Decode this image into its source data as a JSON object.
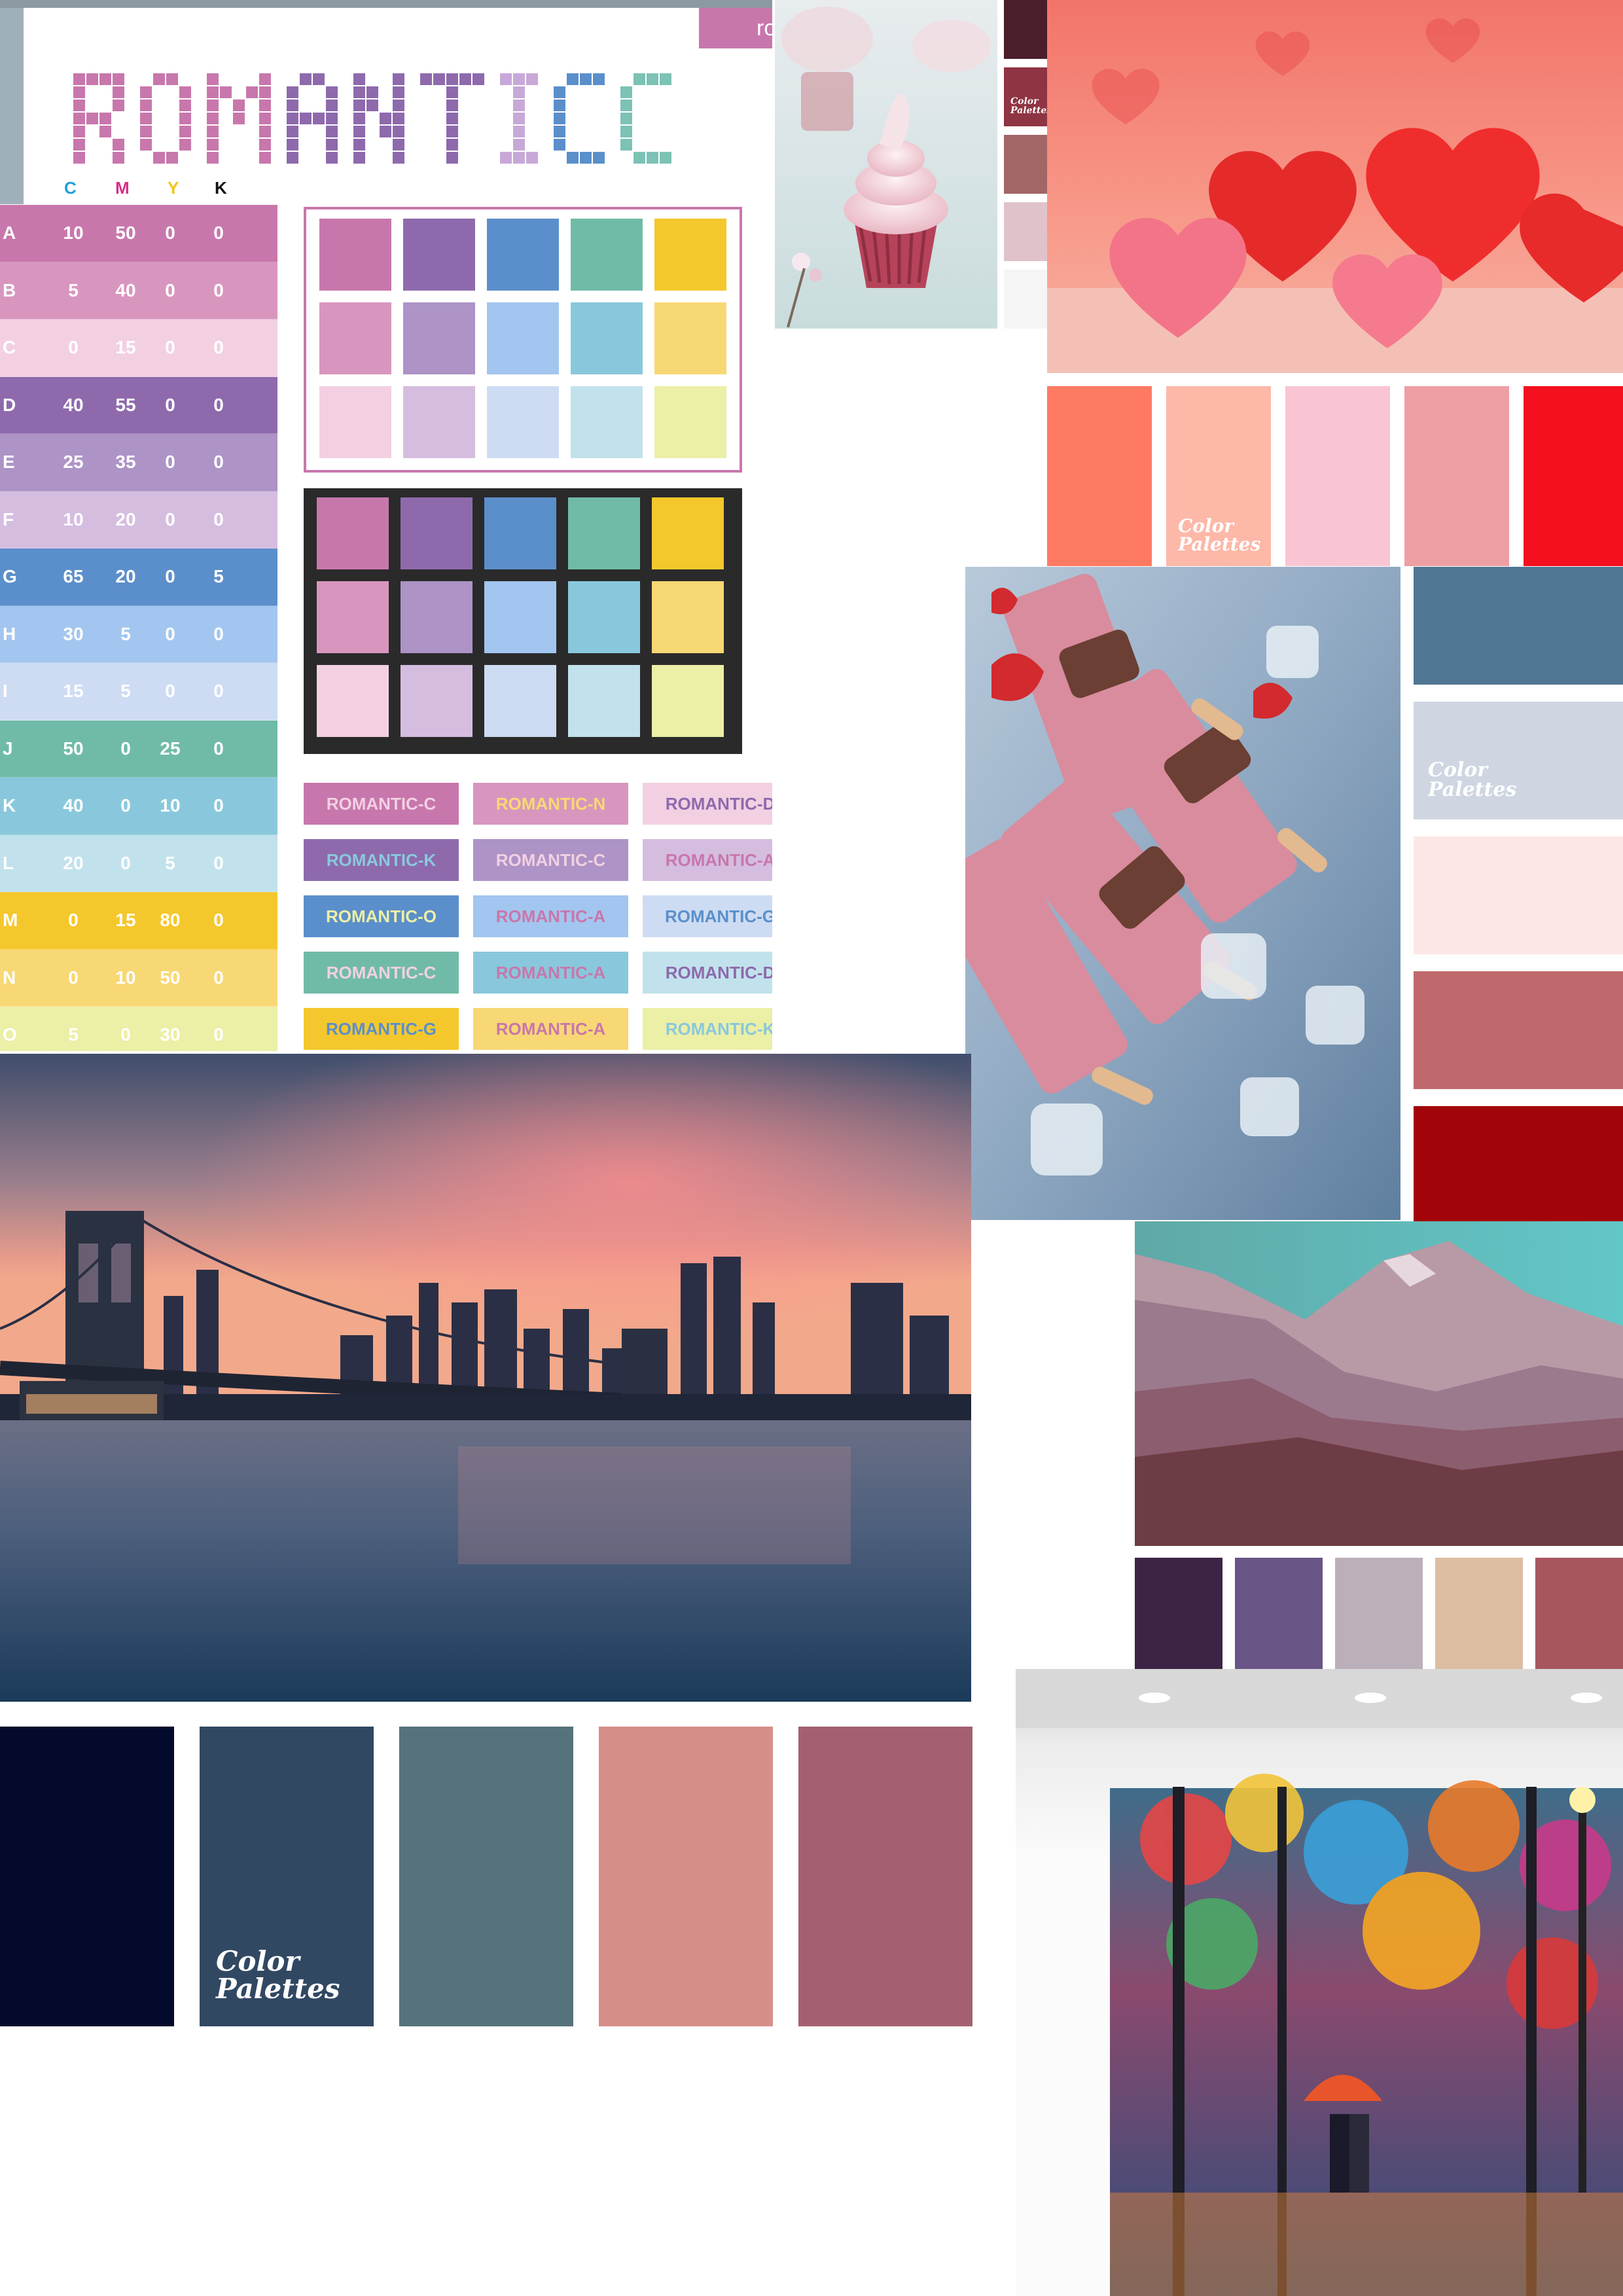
{
  "sheet": {
    "tag_text": "ro",
    "title": "ROMANTIC",
    "title_letter_colors": [
      "#c877ac",
      "#c877ac",
      "#c877ac",
      "#8e6aad",
      "#8e6aad",
      "#8e6aad",
      "#c8a8d8",
      "#5b8fcb",
      "#7cc2b5",
      "#89cce0"
    ],
    "cmyk_headers": {
      "c": "C",
      "m": "M",
      "y": "Y",
      "k": "K"
    },
    "cmyk_header_colors": {
      "c": "#1fa0d8",
      "m": "#d6308a",
      "y": "#f2c51e",
      "k": "#111111"
    },
    "rows": [
      {
        "letter": "A",
        "c": "10",
        "m": "50",
        "y": "0",
        "k": "0",
        "bg": "#c877ac",
        "fg": "#ffffff"
      },
      {
        "letter": "B",
        "c": "5",
        "m": "40",
        "y": "0",
        "k": "0",
        "bg": "#d896bf",
        "fg": "#ffffff"
      },
      {
        "letter": "C",
        "c": "0",
        "m": "15",
        "y": "0",
        "k": "0",
        "bg": "#f2d0e2",
        "fg": "#ffffff"
      },
      {
        "letter": "D",
        "c": "40",
        "m": "55",
        "y": "0",
        "k": "0",
        "bg": "#8e6aad",
        "fg": "#ffffff"
      },
      {
        "letter": "E",
        "c": "25",
        "m": "35",
        "y": "0",
        "k": "0",
        "bg": "#ad93c6",
        "fg": "#ffffff"
      },
      {
        "letter": "F",
        "c": "10",
        "m": "20",
        "y": "0",
        "k": "0",
        "bg": "#d5bde0",
        "fg": "#ffffff"
      },
      {
        "letter": "G",
        "c": "65",
        "m": "20",
        "y": "0",
        "k": "5",
        "bg": "#5b8fcb",
        "fg": "#ffffff"
      },
      {
        "letter": "H",
        "c": "30",
        "m": "5",
        "y": "0",
        "k": "0",
        "bg": "#a2c6ef",
        "fg": "#ffffff"
      },
      {
        "letter": "I",
        "c": "15",
        "m": "5",
        "y": "0",
        "k": "0",
        "bg": "#cddcf3",
        "fg": "#ffffff"
      },
      {
        "letter": "J",
        "c": "50",
        "m": "0",
        "y": "25",
        "k": "0",
        "bg": "#70bba8",
        "fg": "#ffffff"
      },
      {
        "letter": "K",
        "c": "40",
        "m": "0",
        "y": "10",
        "k": "0",
        "bg": "#89c8dc",
        "fg": "#ffffff"
      },
      {
        "letter": "L",
        "c": "20",
        "m": "0",
        "y": "5",
        "k": "0",
        "bg": "#c1e2ec",
        "fg": "#ffffff"
      },
      {
        "letter": "M",
        "c": "0",
        "m": "15",
        "y": "80",
        "k": "0",
        "bg": "#f4c82c",
        "fg": "#ffffff"
      },
      {
        "letter": "N",
        "c": "0",
        "m": "10",
        "y": "50",
        "k": "0",
        "bg": "#f8d874",
        "fg": "#ffffff"
      },
      {
        "letter": "O",
        "c": "5",
        "m": "0",
        "y": "30",
        "k": "0",
        "bg": "#ecefa6",
        "fg": "#ffffff"
      }
    ],
    "grid_colors": [
      [
        "#c877ac",
        "#8e6aad",
        "#5b8fcb",
        "#70bba8",
        "#f4c82c"
      ],
      [
        "#d896bf",
        "#ad93c6",
        "#a2c6ef",
        "#89c8dc",
        "#f8d874"
      ],
      [
        "#f2d0e2",
        "#d5bde0",
        "#cddcf3",
        "#c1e2ec",
        "#ecefa6"
      ]
    ],
    "labels": [
      {
        "text": "ROMANTIC-C",
        "bg": "#c877ac",
        "fg": "#f2d0e2"
      },
      {
        "text": "ROMANTIC-N",
        "bg": "#d896bf",
        "fg": "#f8d874"
      },
      {
        "text": "ROMANTIC-D",
        "bg": "#f2d0e2",
        "fg": "#8e6aad"
      },
      {
        "text": "ROMANTIC-K",
        "bg": "#8e6aad",
        "fg": "#89c8dc"
      },
      {
        "text": "ROMANTIC-C",
        "bg": "#ad93c6",
        "fg": "#f2d0e2"
      },
      {
        "text": "ROMANTIC-A",
        "bg": "#d5bde0",
        "fg": "#c877ac"
      },
      {
        "text": "ROMANTIC-O",
        "bg": "#5b8fcb",
        "fg": "#ecefa6"
      },
      {
        "text": "ROMANTIC-A",
        "bg": "#a2c6ef",
        "fg": "#c877ac"
      },
      {
        "text": "ROMANTIC-G",
        "bg": "#cddcf3",
        "fg": "#5b8fcb"
      },
      {
        "text": "ROMANTIC-C",
        "bg": "#70bba8",
        "fg": "#f2d0e2"
      },
      {
        "text": "ROMANTIC-A",
        "bg": "#89c8dc",
        "fg": "#c877ac"
      },
      {
        "text": "ROMANTIC-D",
        "bg": "#c1e2ec",
        "fg": "#8e6aad"
      },
      {
        "text": "ROMANTIC-G",
        "bg": "#f4c82c",
        "fg": "#5b8fcb"
      },
      {
        "text": "ROMANTIC-A",
        "bg": "#f8d874",
        "fg": "#c877ac"
      },
      {
        "text": "ROMANTIC-K",
        "bg": "#ecefa6",
        "fg": "#89c8dc"
      }
    ]
  },
  "palettes": {
    "cupcake_strip": [
      "#4a1e2a",
      "#8e3442",
      "#a36666",
      "#e0c3ca",
      "#f5f5f5"
    ],
    "cupcake_logo": "Color\nPalettes",
    "hearts": [
      "#ff7a62",
      "#fdb8a8",
      "#f9c5d2",
      "#ee9fa4",
      "#f5101f"
    ],
    "hearts_logo": "Color\nPalettes",
    "popsicle": [
      "#4f7693",
      "#cfd6e2",
      "#fde7e6",
      "#c0696c",
      "#a20409"
    ],
    "popsicle_logo": "Color\nPalettes",
    "city": [
      "#040a2b",
      "#314862",
      "#56727c",
      "#d68e89",
      "#a46070"
    ],
    "city_logo": "Color\nPalettes",
    "mountain": [
      "#3c2446",
      "#695586",
      "#bbafba",
      "#ddbda1",
      "#a7565f"
    ]
  }
}
